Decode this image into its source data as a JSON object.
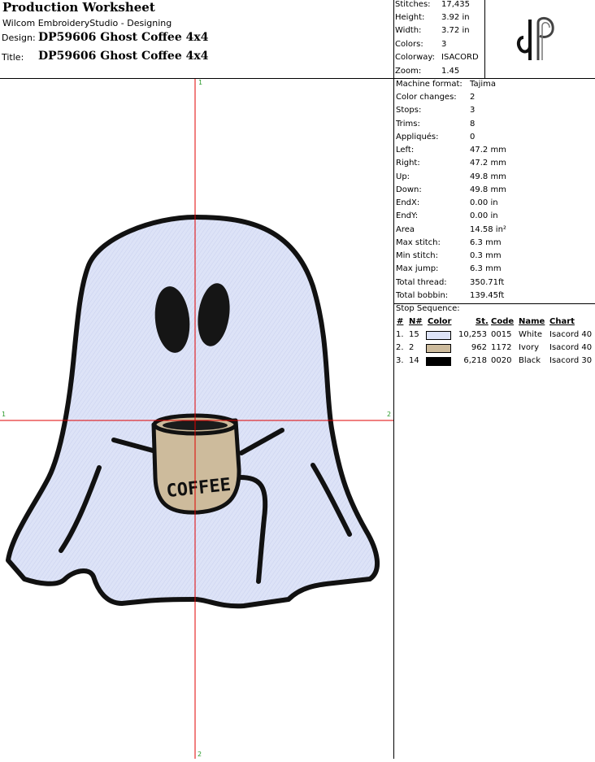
{
  "header": {
    "title": "Production Worksheet",
    "subtitle": "Wilcom EmbroideryStudio - Designing",
    "design_label": "Design:",
    "design_value": "DP59606 Ghost Coffee 4x4",
    "title_label": "Title:",
    "title_value": "DP59606 Ghost Coffee 4x4"
  },
  "summary": [
    {
      "label": "Stitches:",
      "value": "17,435"
    },
    {
      "label": "Height:",
      "value": "3.92 in"
    },
    {
      "label": "Width:",
      "value": "3.72 in"
    },
    {
      "label": "Colors:",
      "value": "3"
    },
    {
      "label": "Colorway:",
      "value": "ISACORD"
    },
    {
      "label": "Zoom:",
      "value": "1.45"
    }
  ],
  "logo": {
    "text": "dP"
  },
  "details": [
    {
      "label": "Machine format:",
      "value": "Tajima"
    },
    {
      "label": "Color changes:",
      "value": "2"
    },
    {
      "label": "Stops:",
      "value": "3"
    },
    {
      "label": "Trims:",
      "value": "8"
    },
    {
      "label": "Appliqués:",
      "value": "0"
    },
    {
      "label": "Left:",
      "value": "47.2 mm"
    },
    {
      "label": "Right:",
      "value": "47.2 mm"
    },
    {
      "label": "Up:",
      "value": "49.8 mm"
    },
    {
      "label": "Down:",
      "value": "49.8 mm"
    },
    {
      "label": "EndX:",
      "value": "0.00 in"
    },
    {
      "label": "EndY:",
      "value": "0.00 in"
    },
    {
      "label": "Area",
      "value": " 14.58 in²"
    },
    {
      "label": "Max stitch:",
      "value": "6.3 mm"
    },
    {
      "label": "Min stitch:",
      "value": "0.3 mm"
    },
    {
      "label": "Max jump:",
      "value": "6.3 mm"
    },
    {
      "label": "Total thread:",
      "value": "350.71ft"
    },
    {
      "label": "Total bobbin:",
      "value": "139.45ft"
    }
  ],
  "stop_sequence": {
    "title": "Stop Sequence:",
    "headers": {
      "num": "#",
      "needle": "N#",
      "color": "Color",
      "stitches": "St.",
      "code": "Code",
      "name": "Name",
      "chart": "Chart"
    },
    "rows": [
      {
        "num": "1.",
        "needle": "15",
        "color": "#dde3f7",
        "stitches": "10,253",
        "code": "0015",
        "name": "White",
        "chart": "Isacord 40"
      },
      {
        "num": "2.",
        "needle": "2",
        "color": "#cdbb9c",
        "stitches": "962",
        "code": "1172",
        "name": "Ivory",
        "chart": "Isacord 40"
      },
      {
        "num": "3.",
        "needle": "14",
        "color": "#000000",
        "stitches": "6,218",
        "code": "0020",
        "name": "Black",
        "chart": "Isacord 30"
      }
    ]
  },
  "design": {
    "mug_text": "COFFEE",
    "fill_color": "#dde3f7",
    "outline_color": "#111111",
    "mug_color": "#cdbb9c"
  },
  "axis_labels": {
    "top": "1",
    "bottom": "2",
    "left": "1",
    "right": "2"
  }
}
